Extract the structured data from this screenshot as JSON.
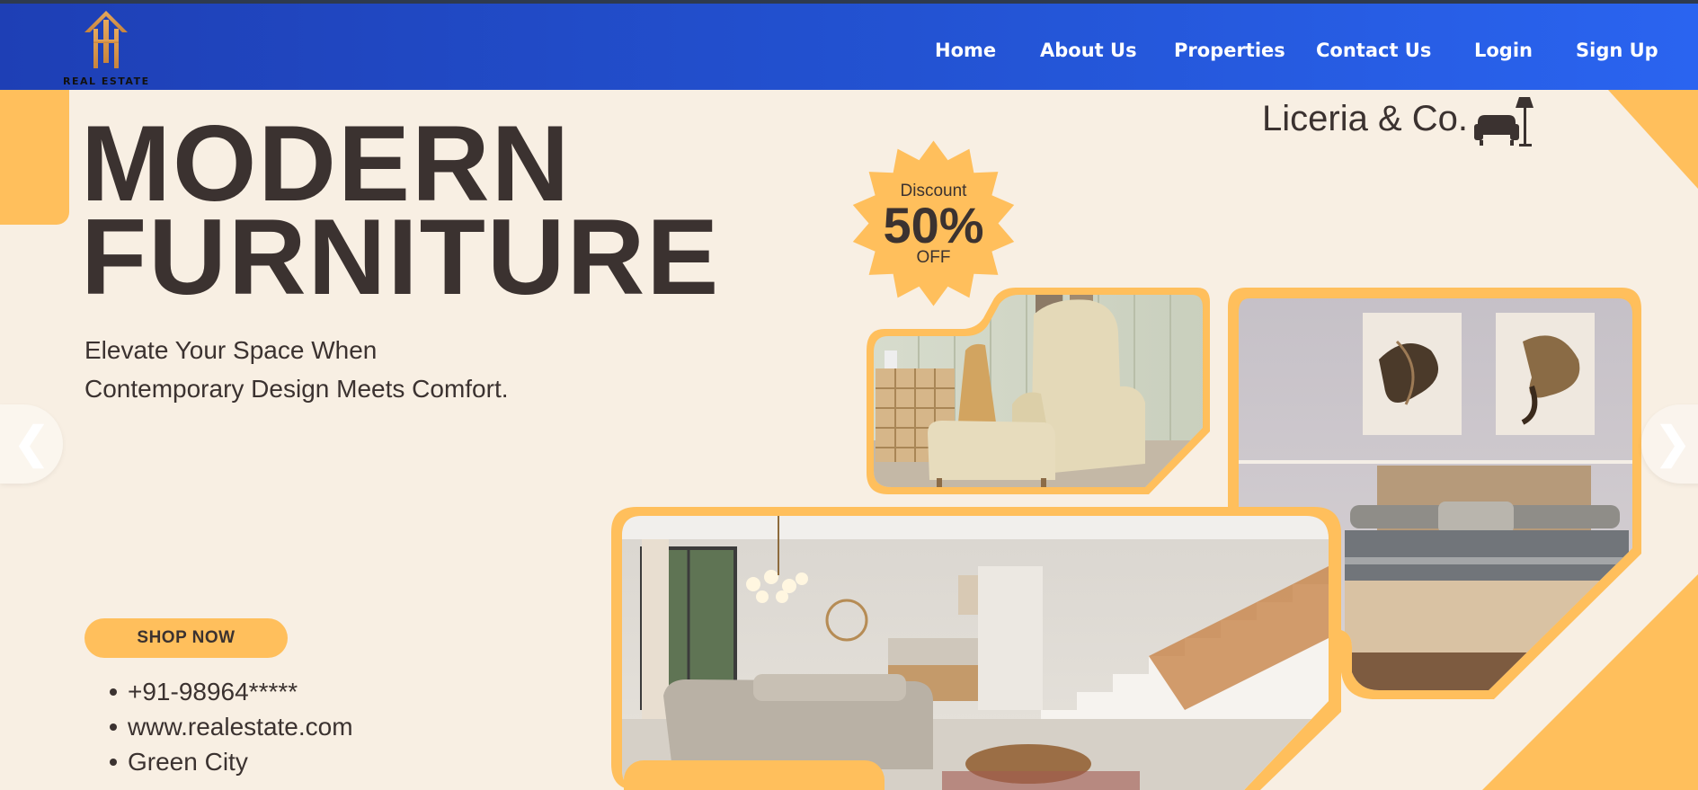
{
  "navbar": {
    "logo_text": "REAL ESTATE",
    "links": [
      "Home",
      "About Us",
      "Properties",
      "Contact Us",
      "Login",
      "Sign Up"
    ]
  },
  "hero": {
    "title_line1": "MODERN",
    "title_line2": "FURNITURE",
    "subtitle_line1": "Elevate Your Space When",
    "subtitle_line2": "Contemporary Design Meets Comfort.",
    "shop_button": "SHOP NOW",
    "contacts": [
      "+91-98964*****",
      "www.realestate.com",
      "Green City"
    ]
  },
  "brand": {
    "name": "Liceria & Co.",
    "icon": "armchair-lamp-icon"
  },
  "discount": {
    "label": "Discount",
    "value": "50%",
    "suffix": "OFF"
  },
  "carousel": {
    "prev_icon": "chevron-left-icon",
    "next_icon": "chevron-right-icon",
    "prev": "❮",
    "next": "❯"
  },
  "colors": {
    "accent": "#ffbf5c",
    "nav_start": "#1e3fb5",
    "nav_end": "#2a64f0",
    "text": "#3b3230",
    "background": "#f8efe3"
  }
}
